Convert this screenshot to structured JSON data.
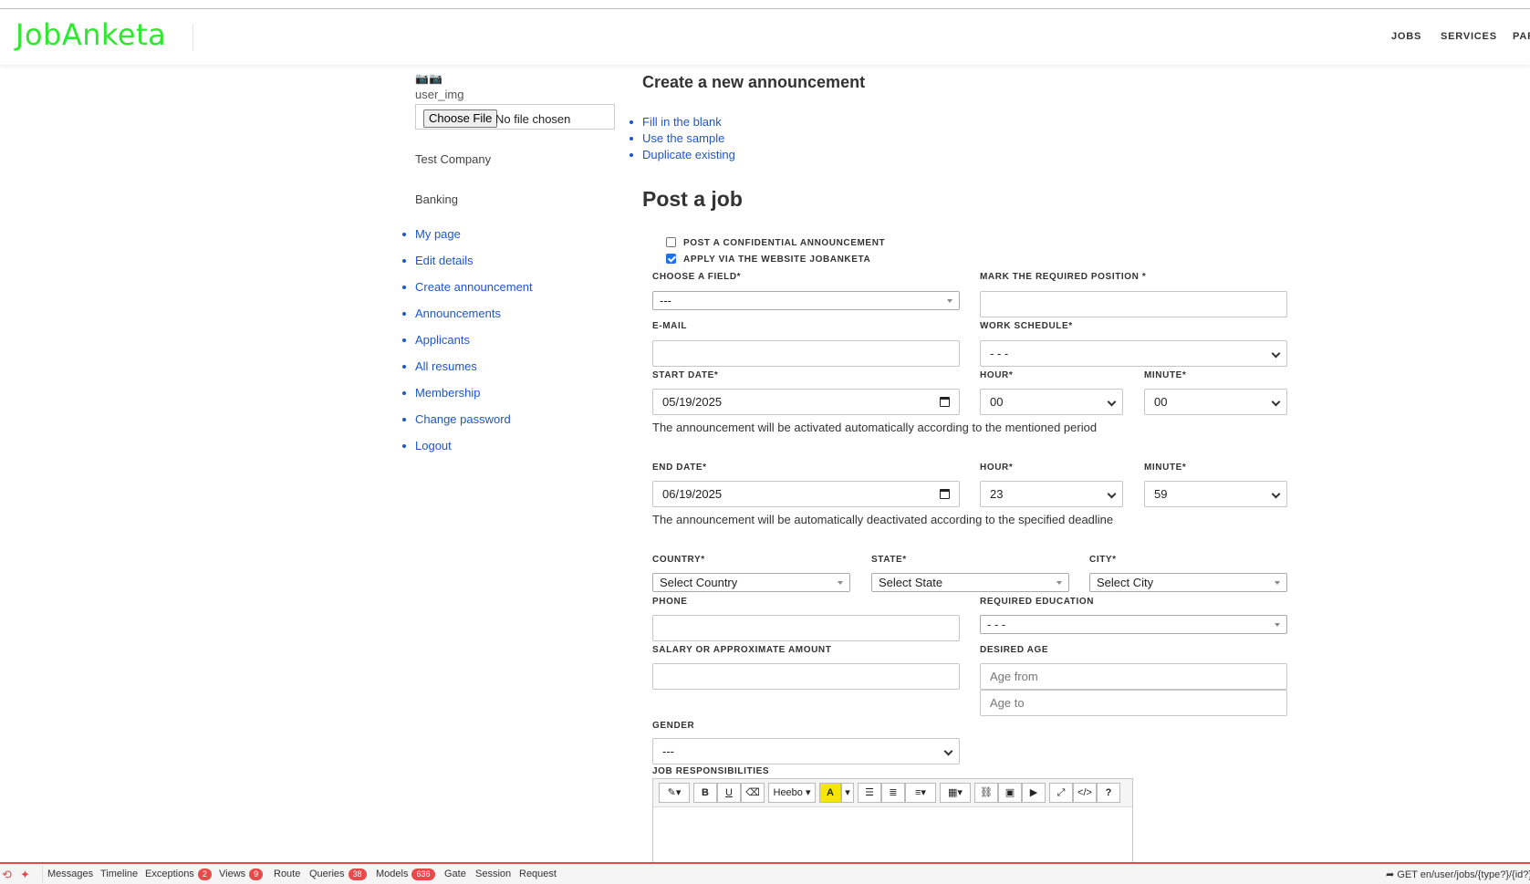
{
  "header": {
    "logo": "JobAnketa",
    "nav": [
      "JOBS",
      "SERVICES",
      "PAR"
    ]
  },
  "sidebar": {
    "camera_icons": "📷📷",
    "user_img_alt": "user_img",
    "file_button": "Choose File",
    "file_status": "No file chosen",
    "company": "Test Company",
    "industry": "Banking",
    "menu": [
      "My page",
      "Edit details",
      "Create announcement",
      "Announcements",
      "Applicants",
      "All resumes",
      "Membership",
      "Change password",
      "Logout"
    ]
  },
  "main": {
    "title": "Create a new announcement",
    "quick_links": [
      "Fill in the blank",
      "Use the sample",
      "Duplicate existing"
    ],
    "post_title": "Post a job",
    "confidential_label": "POST A CONFIDENTIAL ANNOUNCEMENT",
    "confidential_checked": false,
    "apply_label": "APPLY VIA THE WEBSITE JOBANKETA",
    "apply_checked": true,
    "field_label": "CHOOSE A FIELD*",
    "field_value": "---",
    "position_label": "MARK THE REQUIRED POSITION *",
    "position_value": "",
    "email_label": "E-MAIL",
    "email_value": "",
    "schedule_label": "WORK SCHEDULE*",
    "schedule_value": "- - -",
    "start_date_label": "START DATE*",
    "start_date_value": "05/19/2025",
    "start_hour_label": "HOUR*",
    "start_hour_value": "00",
    "start_minute_label": "MINUTE*",
    "start_minute_value": "00",
    "start_note": "The announcement will be activated automatically according to the mentioned period",
    "end_date_label": "END DATE*",
    "end_date_value": "06/19/2025",
    "end_hour_label": "HOUR*",
    "end_hour_value": "23",
    "end_minute_label": "MINUTE*",
    "end_minute_value": "59",
    "end_note": "The announcement will be automatically deactivated according to the specified deadline",
    "country_label": "COUNTRY*",
    "country_value": "Select Country",
    "state_label": "STATE*",
    "state_value": "Select State",
    "city_label": "CITY*",
    "city_value": "Select City",
    "phone_label": "PHONE",
    "phone_value": "",
    "education_label": "REQUIRED EDUCATION",
    "education_value": "- - -",
    "salary_label": "SALARY OR APPROXIMATE AMOUNT",
    "salary_value": "",
    "age_label": "DESIRED AGE",
    "age_from_placeholder": "Age from",
    "age_to_placeholder": "Age to",
    "gender_label": "GENDER",
    "gender_value": "---",
    "responsibilities_label": "JOB RESPONSIBILITIES",
    "editor_font": "Heebo",
    "editor_help": "?"
  },
  "debugbar": {
    "items": [
      "Messages",
      "Timeline",
      "Exceptions",
      "Views",
      "Route",
      "Queries",
      "Models",
      "Gate",
      "Session",
      "Request"
    ],
    "exceptions_count": "2",
    "views_count": "9",
    "queries_count": "38",
    "models_count": "636",
    "route_text": "GET en/user/jobs/{type?}/{id?}"
  },
  "colors": {
    "logo": "#2ee82e",
    "link": "#1f56c9",
    "debug_accent": "#e84a4a"
  }
}
